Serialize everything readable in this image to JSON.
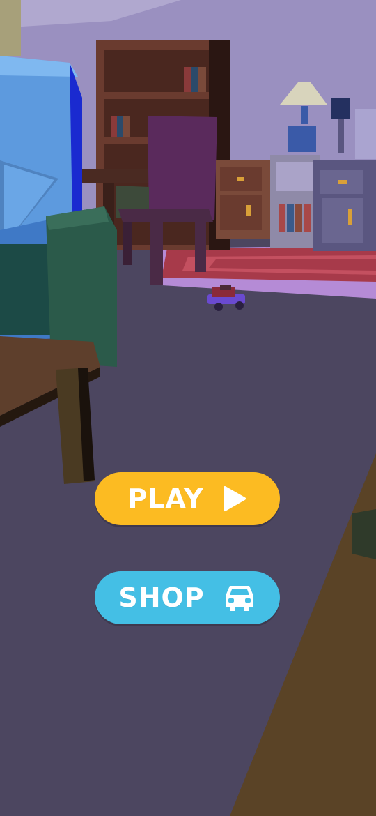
{
  "menu": {
    "play_label": "PLAY",
    "play_icon": "play-triangle-icon",
    "play_color": "#fcbb22",
    "shop_label": "SHOP",
    "shop_icon": "car-icon",
    "shop_color": "#44bfe5"
  },
  "scene": {
    "floor_color": "#4c4660",
    "wall_color": "#9088b8",
    "rug_color": "#a73a4a",
    "wood_color": "#6a3b2f"
  }
}
